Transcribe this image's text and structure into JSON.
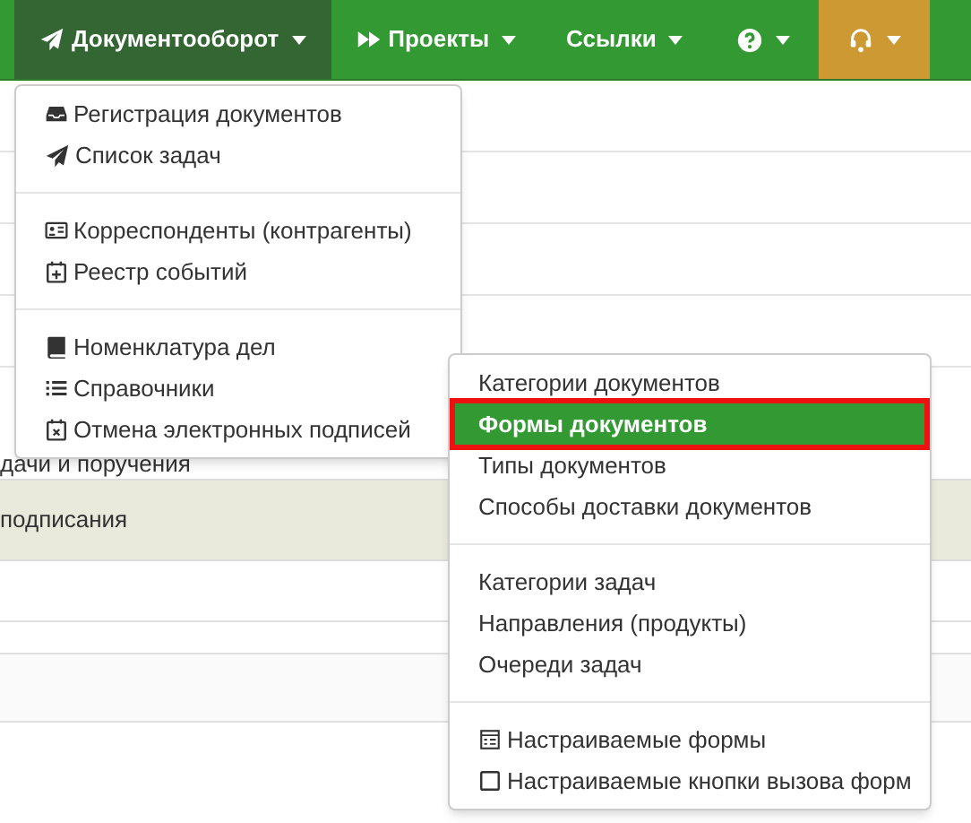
{
  "navbar": {
    "items": [
      {
        "kind": "text",
        "label": "Документооборот",
        "selected": true
      },
      {
        "kind": "text",
        "label": "Проекты",
        "selected": false
      },
      {
        "kind": "text",
        "label": "Ссылки",
        "selected": false
      },
      {
        "kind": "icon",
        "selected": false
      },
      {
        "kind": "icon",
        "selected": false,
        "color": "#cc9933"
      }
    ]
  },
  "background_rows": [
    {
      "text": "дачи и поручения",
      "highlighted": false
    },
    {
      "text": "подписания",
      "highlighted": true
    }
  ],
  "menu": {
    "groups": [
      [
        {
          "label": "Регистрация документов"
        },
        {
          "label": "Список задач"
        }
      ],
      [
        {
          "label": "Корреспонденты (контрагенты)"
        },
        {
          "label": "Реестр событий"
        }
      ],
      [
        {
          "label": "Номенклатура дел"
        },
        {
          "label": "Справочники"
        },
        {
          "label": "Отмена электронных подписей"
        }
      ]
    ]
  },
  "submenu": {
    "groups": [
      [
        {
          "label": "Категории документов",
          "selected": false
        },
        {
          "label": "Формы документов",
          "selected": true
        },
        {
          "label": "Типы документов",
          "selected": false
        },
        {
          "label": "Способы доставки документов",
          "selected": false
        }
      ],
      [
        {
          "label": "Категории задач",
          "selected": false
        },
        {
          "label": "Направления (продукты)",
          "selected": false
        },
        {
          "label": "Очереди задач",
          "selected": false
        }
      ],
      [
        {
          "label": "Настраиваемые формы",
          "selected": false
        },
        {
          "label": "Настраиваемые кнопки вызова форм",
          "selected": false
        }
      ]
    ]
  }
}
